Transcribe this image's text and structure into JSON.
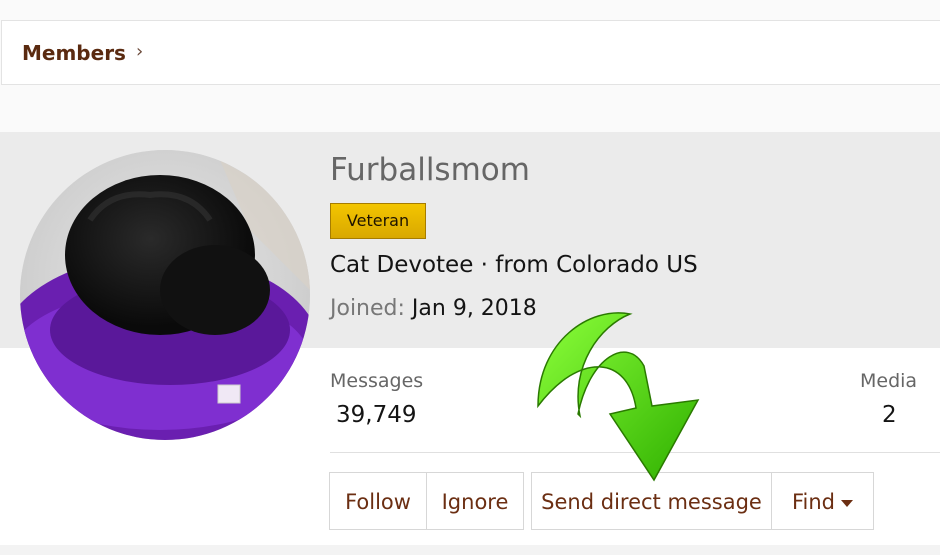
{
  "breadcrumb": {
    "label": "Members",
    "chevron": "›"
  },
  "profile": {
    "username": "Furballsmom",
    "badge": "Veteran",
    "title_line": "Cat Devotee · from Colorado US",
    "joined_label": "Joined:",
    "joined_date": "Jan 9, 2018"
  },
  "stats": {
    "messages_label": "Messages",
    "messages_value": "39,749",
    "media_label": "Media",
    "media_value": "2"
  },
  "actions": {
    "follow": "Follow",
    "ignore": "Ignore",
    "send_dm": "Send direct message",
    "find": "Find"
  },
  "colors": {
    "link": "#6b2e12",
    "badge": "#f3c500",
    "arrow": "#4cd400"
  }
}
